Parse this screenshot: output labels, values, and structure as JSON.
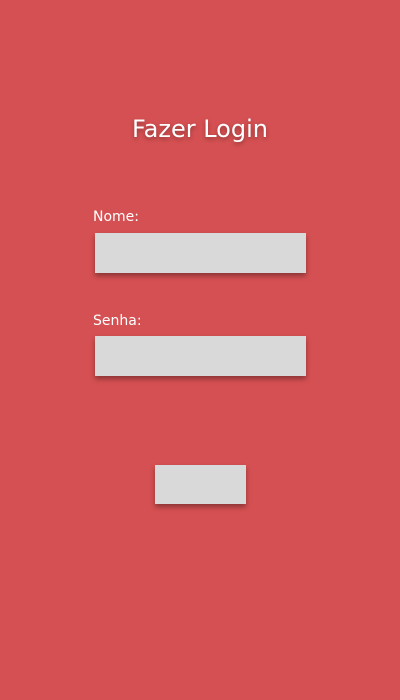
{
  "login": {
    "title": "Fazer Login",
    "name_label": "Nome:",
    "name_value": "",
    "password_label": "Senha:",
    "password_value": "",
    "submit_label": ""
  },
  "colors": {
    "background": "#d55052",
    "field": "#d9d9d9",
    "text": "#ffffff"
  }
}
